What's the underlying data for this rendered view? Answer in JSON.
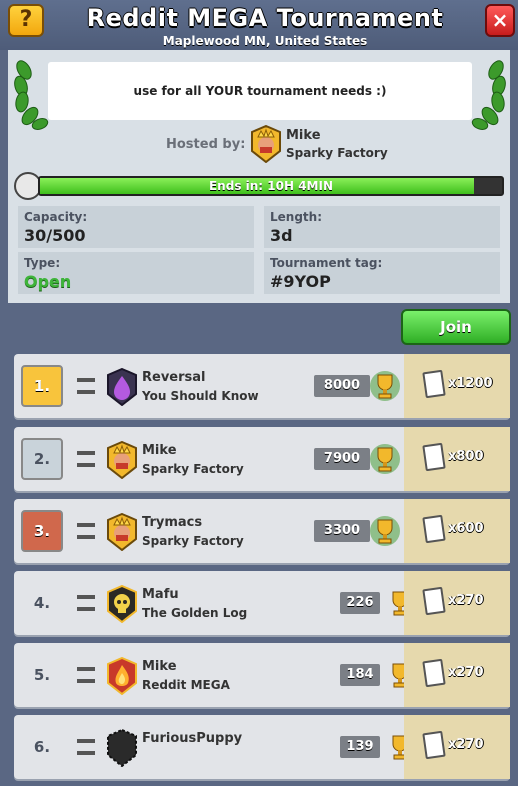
{
  "header": {
    "help_label": "?",
    "title": "Reddit MEGA Tournament",
    "location": "Maplewood MN, United States",
    "close_label": "×"
  },
  "info": {
    "description": "use for all YOUR tournament needs :)",
    "hosted_by_label": "Hosted by:",
    "host_name": "Mike",
    "host_clan": "Sparky Factory",
    "timer_text": "Ends in: 10H 4MIN",
    "timer_progress": 0.94,
    "capacity_label": "Capacity:",
    "capacity_value": "30/500",
    "length_label": "Length:",
    "length_value": "3d",
    "type_label": "Type:",
    "type_value": "Open",
    "tag_label": "Tournament tag:",
    "tag_value": "#9YOP"
  },
  "join_label": "Join",
  "rows": [
    {
      "rank": "1.",
      "name": "Reversal",
      "clan": "You Should Know",
      "score": "8000",
      "reward": "x1200",
      "rank_style": "gold",
      "badge": "purple-drop-badge"
    },
    {
      "rank": "2.",
      "name": "Mike",
      "clan": "Sparky Factory",
      "score": "7900",
      "reward": "x800",
      "rank_style": "silver",
      "badge": "king-badge"
    },
    {
      "rank": "3.",
      "name": "Trymacs",
      "clan": "Sparky Factory",
      "score": "3300",
      "reward": "x600",
      "rank_style": "bronze",
      "badge": "king-badge"
    },
    {
      "rank": "4.",
      "name": "Mafu",
      "clan": "The Golden Log",
      "score": "226",
      "reward": "x270",
      "rank_style": "plain",
      "badge": "skull-badge"
    },
    {
      "rank": "5.",
      "name": "Mike",
      "clan": "Reddit MEGA",
      "score": "184",
      "reward": "x270",
      "rank_style": "plain",
      "badge": "fire-badge"
    },
    {
      "rank": "6.",
      "name": "FuriousPuppy",
      "clan": "",
      "score": "139",
      "reward": "x270",
      "rank_style": "plain",
      "badge": "empty-badge"
    }
  ],
  "colors": {
    "gold": "#f8c43c",
    "silver": "#c9d3da",
    "bronze": "#d0684c"
  }
}
